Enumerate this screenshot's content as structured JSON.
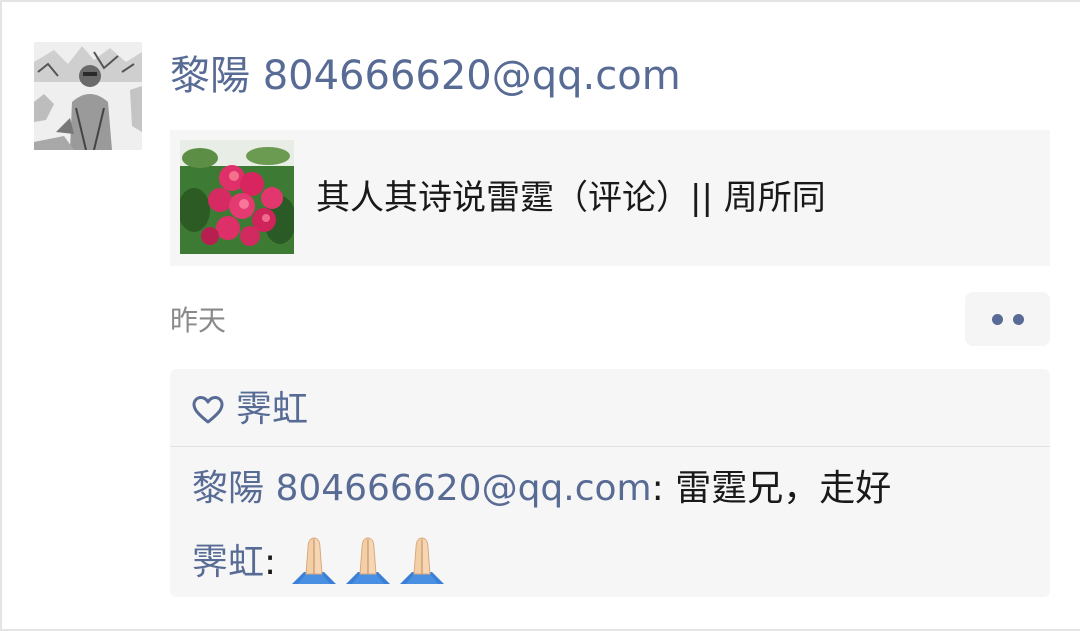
{
  "post": {
    "author": "黎陽 804666620@qq.com",
    "avatar_icon": "person-photo-avatar",
    "link": {
      "title": "其人其诗说雷霆（评论）|| 周所同",
      "thumbnail_icon": "pink-flowers-thumbnail"
    },
    "timestamp": "昨天",
    "more_icon": "two-dots-more-icon"
  },
  "likes": {
    "icon": "heart-outline-icon",
    "names": "霁虹"
  },
  "comments": [
    {
      "author": "黎陽 804666620@qq.com",
      "separator": ": ",
      "text": "雷霆兄，走好"
    },
    {
      "author": "霁虹",
      "separator": ": ",
      "emoji_icon": "folded-hands-emoji",
      "emoji_count": 3
    }
  ],
  "colors": {
    "link_blue": "#576b95",
    "panel_bg": "#f6f6f6",
    "text": "#191919",
    "muted": "#8a8a8a"
  }
}
